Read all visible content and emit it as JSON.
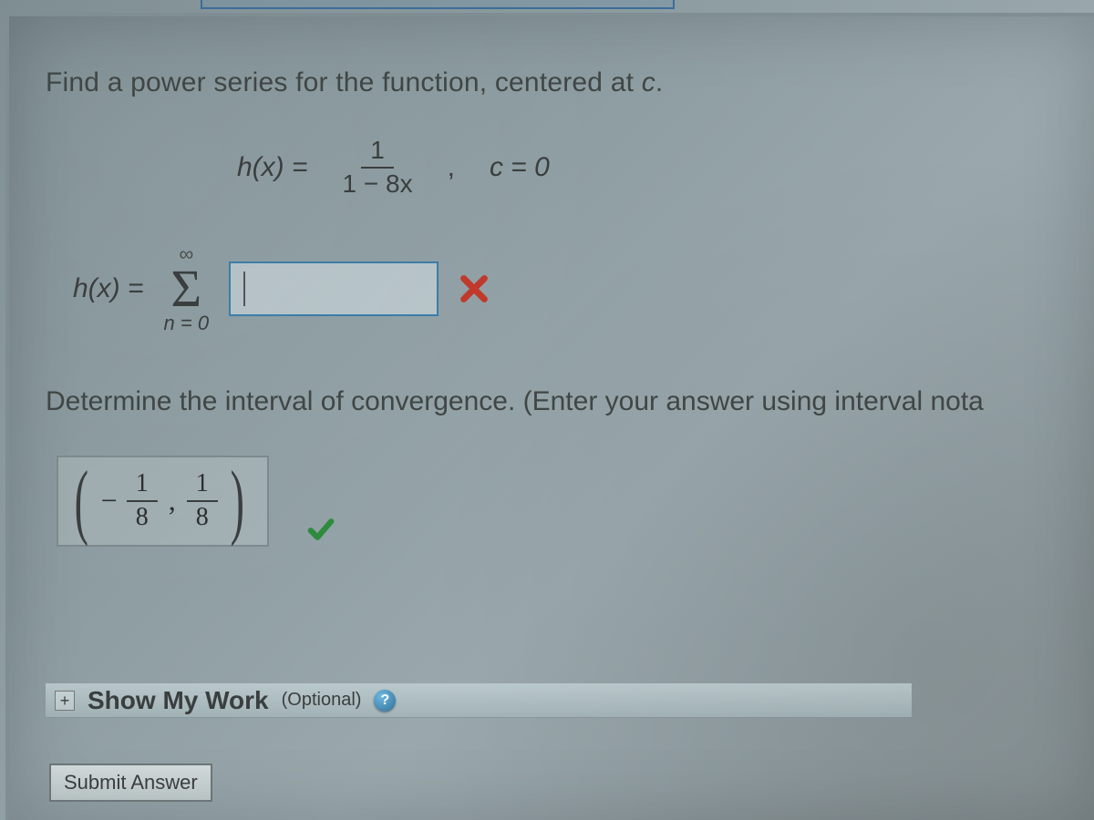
{
  "question": {
    "prompt_prefix": "Find a power series for the function, centered at ",
    "center_var": "c",
    "prompt_suffix": ".",
    "func_lhs": "h(x) =",
    "frac_num": "1",
    "frac_den": "1 − 8x",
    "center_eq": "c = 0"
  },
  "answer1": {
    "lhs": "h(x) =",
    "sigma_top": "∞",
    "sigma_bottom": "n = 0",
    "value": "",
    "status": "incorrect"
  },
  "section2": {
    "text": "Determine the interval of convergence. (Enter your answer using interval nota"
  },
  "answer2": {
    "display": {
      "neg": "−",
      "f1_num": "1",
      "f1_den": "8",
      "comma": ",",
      "f2_num": "1",
      "f2_den": "8"
    },
    "status": "correct"
  },
  "show_my_work": {
    "label": "Show My Work",
    "optional": "(Optional)"
  },
  "submit_label": "Submit Answer"
}
